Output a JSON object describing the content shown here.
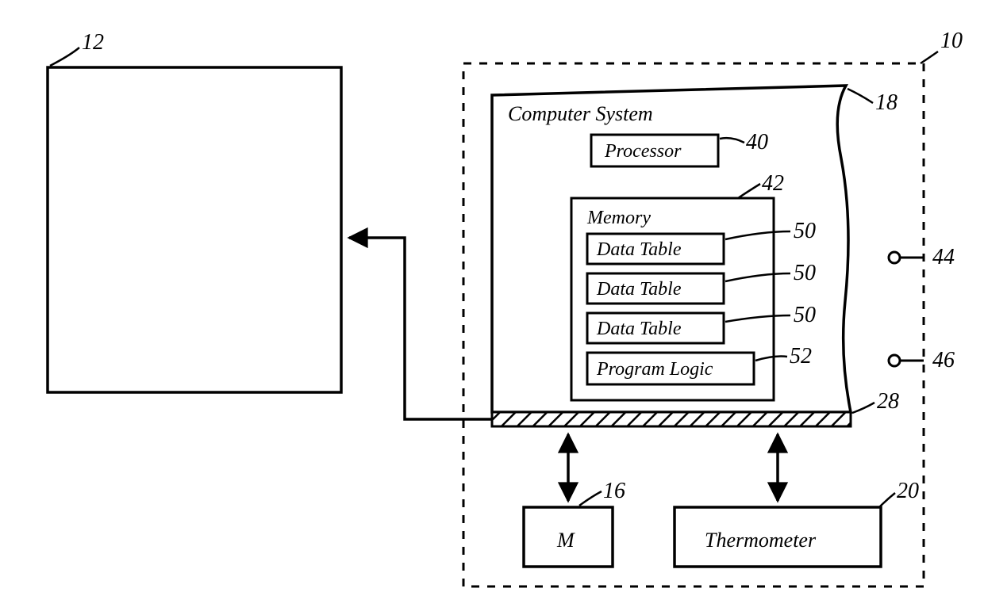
{
  "refs": {
    "n12": "12",
    "n10": "10",
    "n18": "18",
    "n40": "40",
    "n42": "42",
    "n50a": "50",
    "n50b": "50",
    "n50c": "50",
    "n52": "52",
    "n44": "44",
    "n46": "46",
    "n28": "28",
    "n16": "16",
    "n20": "20"
  },
  "labels": {
    "computer_system": "Computer System",
    "processor": "Processor",
    "memory": "Memory",
    "data_table_1": "Data Table",
    "data_table_2": "Data Table",
    "data_table_3": "Data Table",
    "program_logic": "Program Logic",
    "m": "M",
    "thermometer": "Thermometer"
  }
}
